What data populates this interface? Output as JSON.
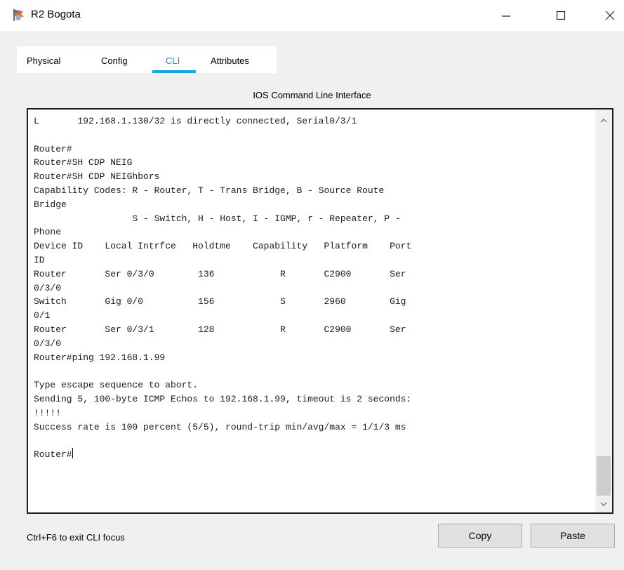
{
  "window": {
    "title": "R2 Bogota",
    "app_icon": "router-icon",
    "minimize_glyph": "—",
    "maximize_glyph": "☐",
    "close_glyph": "✕"
  },
  "tabs": [
    {
      "label": "Physical",
      "active": false
    },
    {
      "label": "Config",
      "active": false
    },
    {
      "label": "CLI",
      "active": true
    },
    {
      "label": "Attributes",
      "active": false
    }
  ],
  "cli": {
    "caption": "IOS Command Line Interface",
    "lines": [
      "L       192.168.1.130/32 is directly connected, Serial0/3/1",
      "",
      "Router#",
      "Router#SH CDP NEIG",
      "Router#SH CDP NEIGhbors",
      "Capability Codes: R - Router, T - Trans Bridge, B - Source Route",
      "Bridge",
      "                  S - Switch, H - Host, I - IGMP, r - Repeater, P -",
      "Phone",
      "Device ID    Local Intrfce   Holdtme    Capability   Platform    Port",
      "ID",
      "Router       Ser 0/3/0        136            R       C2900       Ser",
      "0/3/0",
      "Switch       Gig 0/0          156            S       2960        Gig",
      "0/1",
      "Router       Ser 0/3/1        128            R       C2900       Ser",
      "0/3/0",
      "Router#ping 192.168.1.99",
      "",
      "Type escape sequence to abort.",
      "Sending 5, 100-byte ICMP Echos to 192.168.1.99, timeout is 2 seconds:",
      "!!!!!",
      "Success rate is 100 percent (5/5), round-trip min/avg/max = 1/1/3 ms",
      "",
      "Router#"
    ]
  },
  "footer": {
    "hint": "Ctrl+F6 to exit CLI focus",
    "copy_label": "Copy",
    "paste_label": "Paste"
  },
  "colors": {
    "accent": "#1aa3e0",
    "active_tab_text": "#1f8ddb"
  }
}
